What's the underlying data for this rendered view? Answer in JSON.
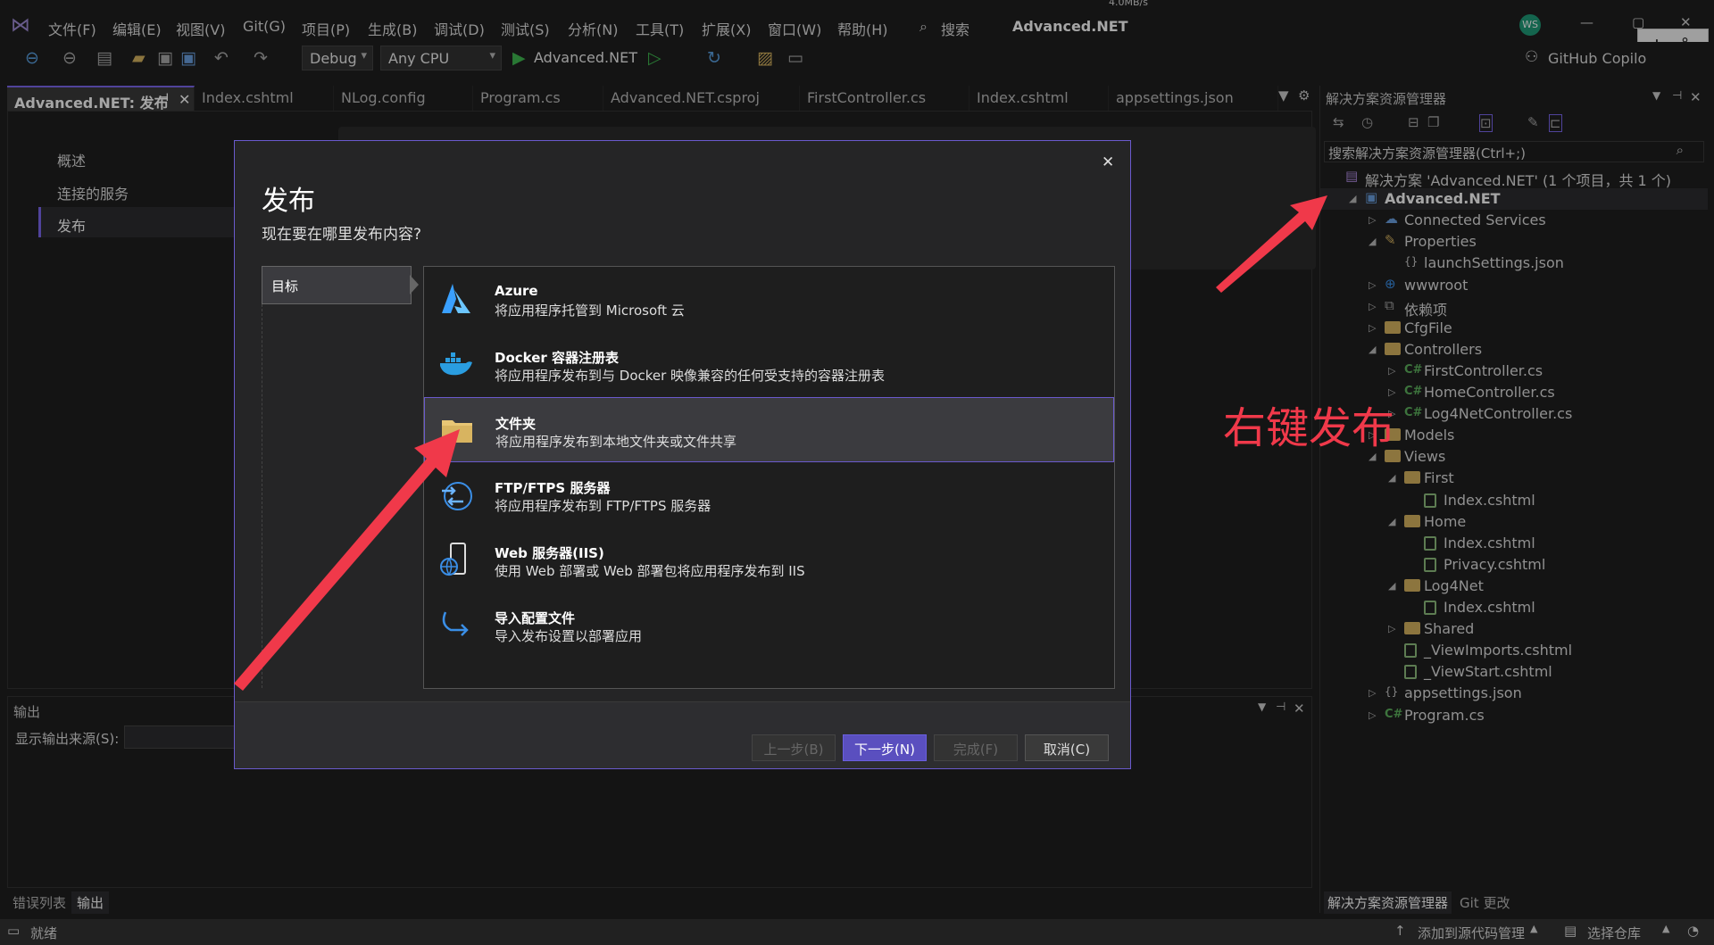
{
  "menu": {
    "items": [
      "文件(F)",
      "编辑(E)",
      "视图(V)",
      "Git(G)",
      "项目(P)",
      "生成(B)",
      "调试(D)",
      "测试(S)",
      "分析(N)",
      "工具(T)",
      "扩展(X)",
      "窗口(W)",
      "帮助(H)"
    ],
    "search": "搜索",
    "title": "Advanced.NET",
    "net_speed": "4.0MB/s",
    "avatar": "WS",
    "ime_char": "中",
    "copilot": "GitHub Copilo"
  },
  "toolbar": {
    "config": "Debug",
    "platform": "Any CPU",
    "run_target": "Advanced.NET"
  },
  "tabs": [
    "Advanced.NET: 发布",
    "Index.cshtml",
    "NLog.config",
    "Program.cs",
    "Advanced.NET.csproj",
    "FirstController.cs",
    "Index.cshtml",
    "appsettings.json"
  ],
  "doc_nav": [
    "概述",
    "连接的服务",
    "发布"
  ],
  "output": {
    "title": "输出",
    "source_label": "显示输出来源(S):"
  },
  "bottom_tabs": [
    "错误列表",
    "输出"
  ],
  "solution_explorer": {
    "title": "解决方案资源管理器",
    "search_placeholder": "搜索解决方案资源管理器(Ctrl+;)",
    "items": [
      {
        "label": "解决方案 'Advanced.NET' (1 个项目，共 1 个)",
        "icon": "solution-icon"
      },
      {
        "label": "Advanced.NET",
        "icon": "project-icon"
      },
      {
        "label": "Connected Services",
        "icon": "connected-services-icon"
      },
      {
        "label": "Properties",
        "icon": "properties-icon"
      },
      {
        "label": "launchSettings.json",
        "icon": "json-icon"
      },
      {
        "label": "wwwroot",
        "icon": "globe-icon"
      },
      {
        "label": "依赖项",
        "icon": "dependencies-icon"
      },
      {
        "label": "CfgFile",
        "icon": "folder-icon"
      },
      {
        "label": "Controllers",
        "icon": "folder-icon"
      },
      {
        "label": "FirstController.cs",
        "icon": "csharp-icon"
      },
      {
        "label": "HomeController.cs",
        "icon": "csharp-icon"
      },
      {
        "label": "Log4NetController.cs",
        "icon": "csharp-icon"
      },
      {
        "label": "Models",
        "icon": "folder-icon"
      },
      {
        "label": "Views",
        "icon": "folder-icon"
      },
      {
        "label": "First",
        "icon": "folder-icon"
      },
      {
        "label": "Index.cshtml",
        "icon": "cshtml-icon"
      },
      {
        "label": "Home",
        "icon": "folder-icon"
      },
      {
        "label": "Index.cshtml",
        "icon": "cshtml-icon"
      },
      {
        "label": "Privacy.cshtml",
        "icon": "cshtml-icon"
      },
      {
        "label": "Log4Net",
        "icon": "folder-icon"
      },
      {
        "label": "Index.cshtml",
        "icon": "cshtml-icon"
      },
      {
        "label": "Shared",
        "icon": "folder-icon"
      },
      {
        "label": "_ViewImports.cshtml",
        "icon": "cshtml-icon"
      },
      {
        "label": "_ViewStart.cshtml",
        "icon": "cshtml-icon"
      },
      {
        "label": "appsettings.json",
        "icon": "json-icon"
      },
      {
        "label": "Program.cs",
        "icon": "csharp-icon"
      }
    ],
    "bottom_tabs": [
      "解决方案资源管理器",
      "Git 更改"
    ]
  },
  "dialog": {
    "title": "发布",
    "subtitle": "现在要在哪里发布内容?",
    "step": "目标",
    "options": [
      {
        "title": "Azure",
        "desc": "将应用程序托管到 Microsoft 云",
        "icon": "azure-icon"
      },
      {
        "title": "Docker 容器注册表",
        "desc": "将应用程序发布到与 Docker 映像兼容的任何受支持的容器注册表",
        "icon": "docker-icon"
      },
      {
        "title": "文件夹",
        "desc": "将应用程序发布到本地文件夹或文件共享",
        "icon": "folder-icon"
      },
      {
        "title": "FTP/FTPS 服务器",
        "desc": "将应用程序发布到 FTP/FTPS 服务器",
        "icon": "ftp-icon"
      },
      {
        "title": "Web 服务器(IIS)",
        "desc": "使用 Web 部署或 Web 部署包将应用程序发布到 IIS",
        "icon": "web-server-icon"
      },
      {
        "title": "导入配置文件",
        "desc": "导入发布设置以部署应用",
        "icon": "import-icon"
      }
    ],
    "selected_option": 2,
    "buttons": {
      "prev": "上一步(B)",
      "next": "下一步(N)",
      "finish": "完成(F)",
      "cancel": "取消(C)"
    }
  },
  "annotation": "右键发布",
  "status": {
    "ready": "就绪",
    "source_control": "添加到源代码管理",
    "repo": "选择仓库"
  },
  "colors": {
    "accent": "#6a5acd",
    "arrow": "#f0394a",
    "folder": "#d8b460"
  }
}
